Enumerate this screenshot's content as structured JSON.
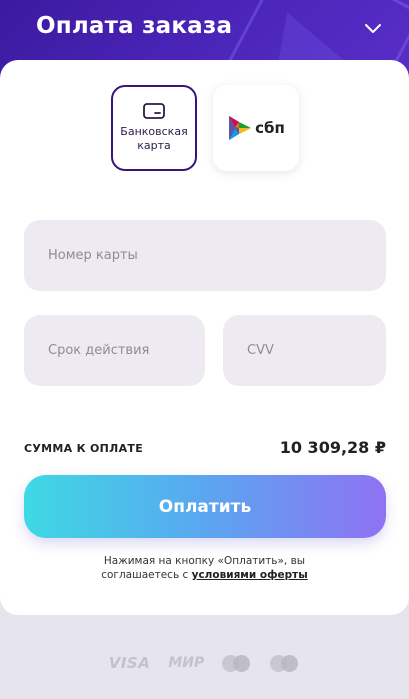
{
  "header": {
    "title": "Оплата заказа"
  },
  "payment_methods": [
    {
      "id": "bank-card",
      "label": "Банковская карта",
      "selected": true,
      "icon": "card-icon"
    },
    {
      "id": "sbp",
      "label": "сбп",
      "selected": false,
      "icon": "sbp-logo-icon"
    }
  ],
  "form": {
    "card_number_placeholder": "Номер карты",
    "expiry_placeholder": "Срок действия",
    "cvv_placeholder": "CVV"
  },
  "summary": {
    "label": "СУММА К ОПЛАТЕ",
    "amount": "10 309,28 ₽"
  },
  "pay_button": {
    "label": "Оплатить"
  },
  "terms": {
    "line1": "Нажимая на кнопку «Оплатить», вы",
    "line2_prefix": "соглашаетесь с ",
    "link_text": "условиями оферты"
  },
  "footer_logos": {
    "visa": "VISA",
    "mir": "МИР"
  },
  "colors": {
    "header_bg": "#4a24b8",
    "accent_border": "#3a1578",
    "field_bg": "#edebf1",
    "button_gradient_start": "#3ed9e4",
    "button_gradient_end": "#8f72f2"
  }
}
